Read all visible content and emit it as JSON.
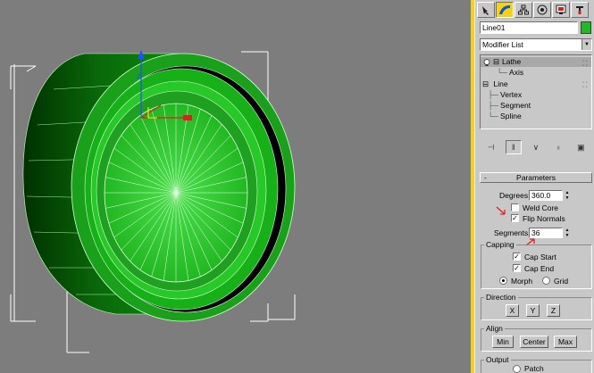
{
  "panel": {
    "tabs": [
      {
        "icon": "create-icon"
      },
      {
        "icon": "modify-icon",
        "active": true
      },
      {
        "icon": "hierarchy-icon"
      },
      {
        "icon": "motion-icon"
      },
      {
        "icon": "display-icon"
      },
      {
        "icon": "utilities-icon"
      }
    ],
    "object_name": "Line01",
    "object_color": "#22b822",
    "modifier_list": "Modifier List",
    "stack": {
      "lathe": "Lathe",
      "axis": "Axis",
      "line": "Line",
      "vertex": "Vertex",
      "segment": "Segment",
      "spline": "Spline"
    }
  },
  "parameters": {
    "title": "Parameters",
    "collapse": "-",
    "degrees_label": "Degrees:",
    "degrees_value": "360.0",
    "weld_core": "Weld Core",
    "flip_normals": "Flip Normals",
    "segments_label": "Segments:",
    "segments_value": "36",
    "capping_title": "Capping",
    "cap_start": "Cap Start",
    "cap_end": "Cap End",
    "morph": "Morph",
    "grid": "Grid",
    "direction_title": "Direction",
    "x": "X",
    "y": "Y",
    "z": "Z",
    "align_title": "Align",
    "min": "Min",
    "center": "Center",
    "max": "Max",
    "output_title": "Output",
    "patch": "Patch"
  },
  "colors": {
    "viewport_bg": "#7d7d7d",
    "active_border": "#f2d21b",
    "mesh_green": "#1fbf1f",
    "annotation_red": "#e02020"
  }
}
